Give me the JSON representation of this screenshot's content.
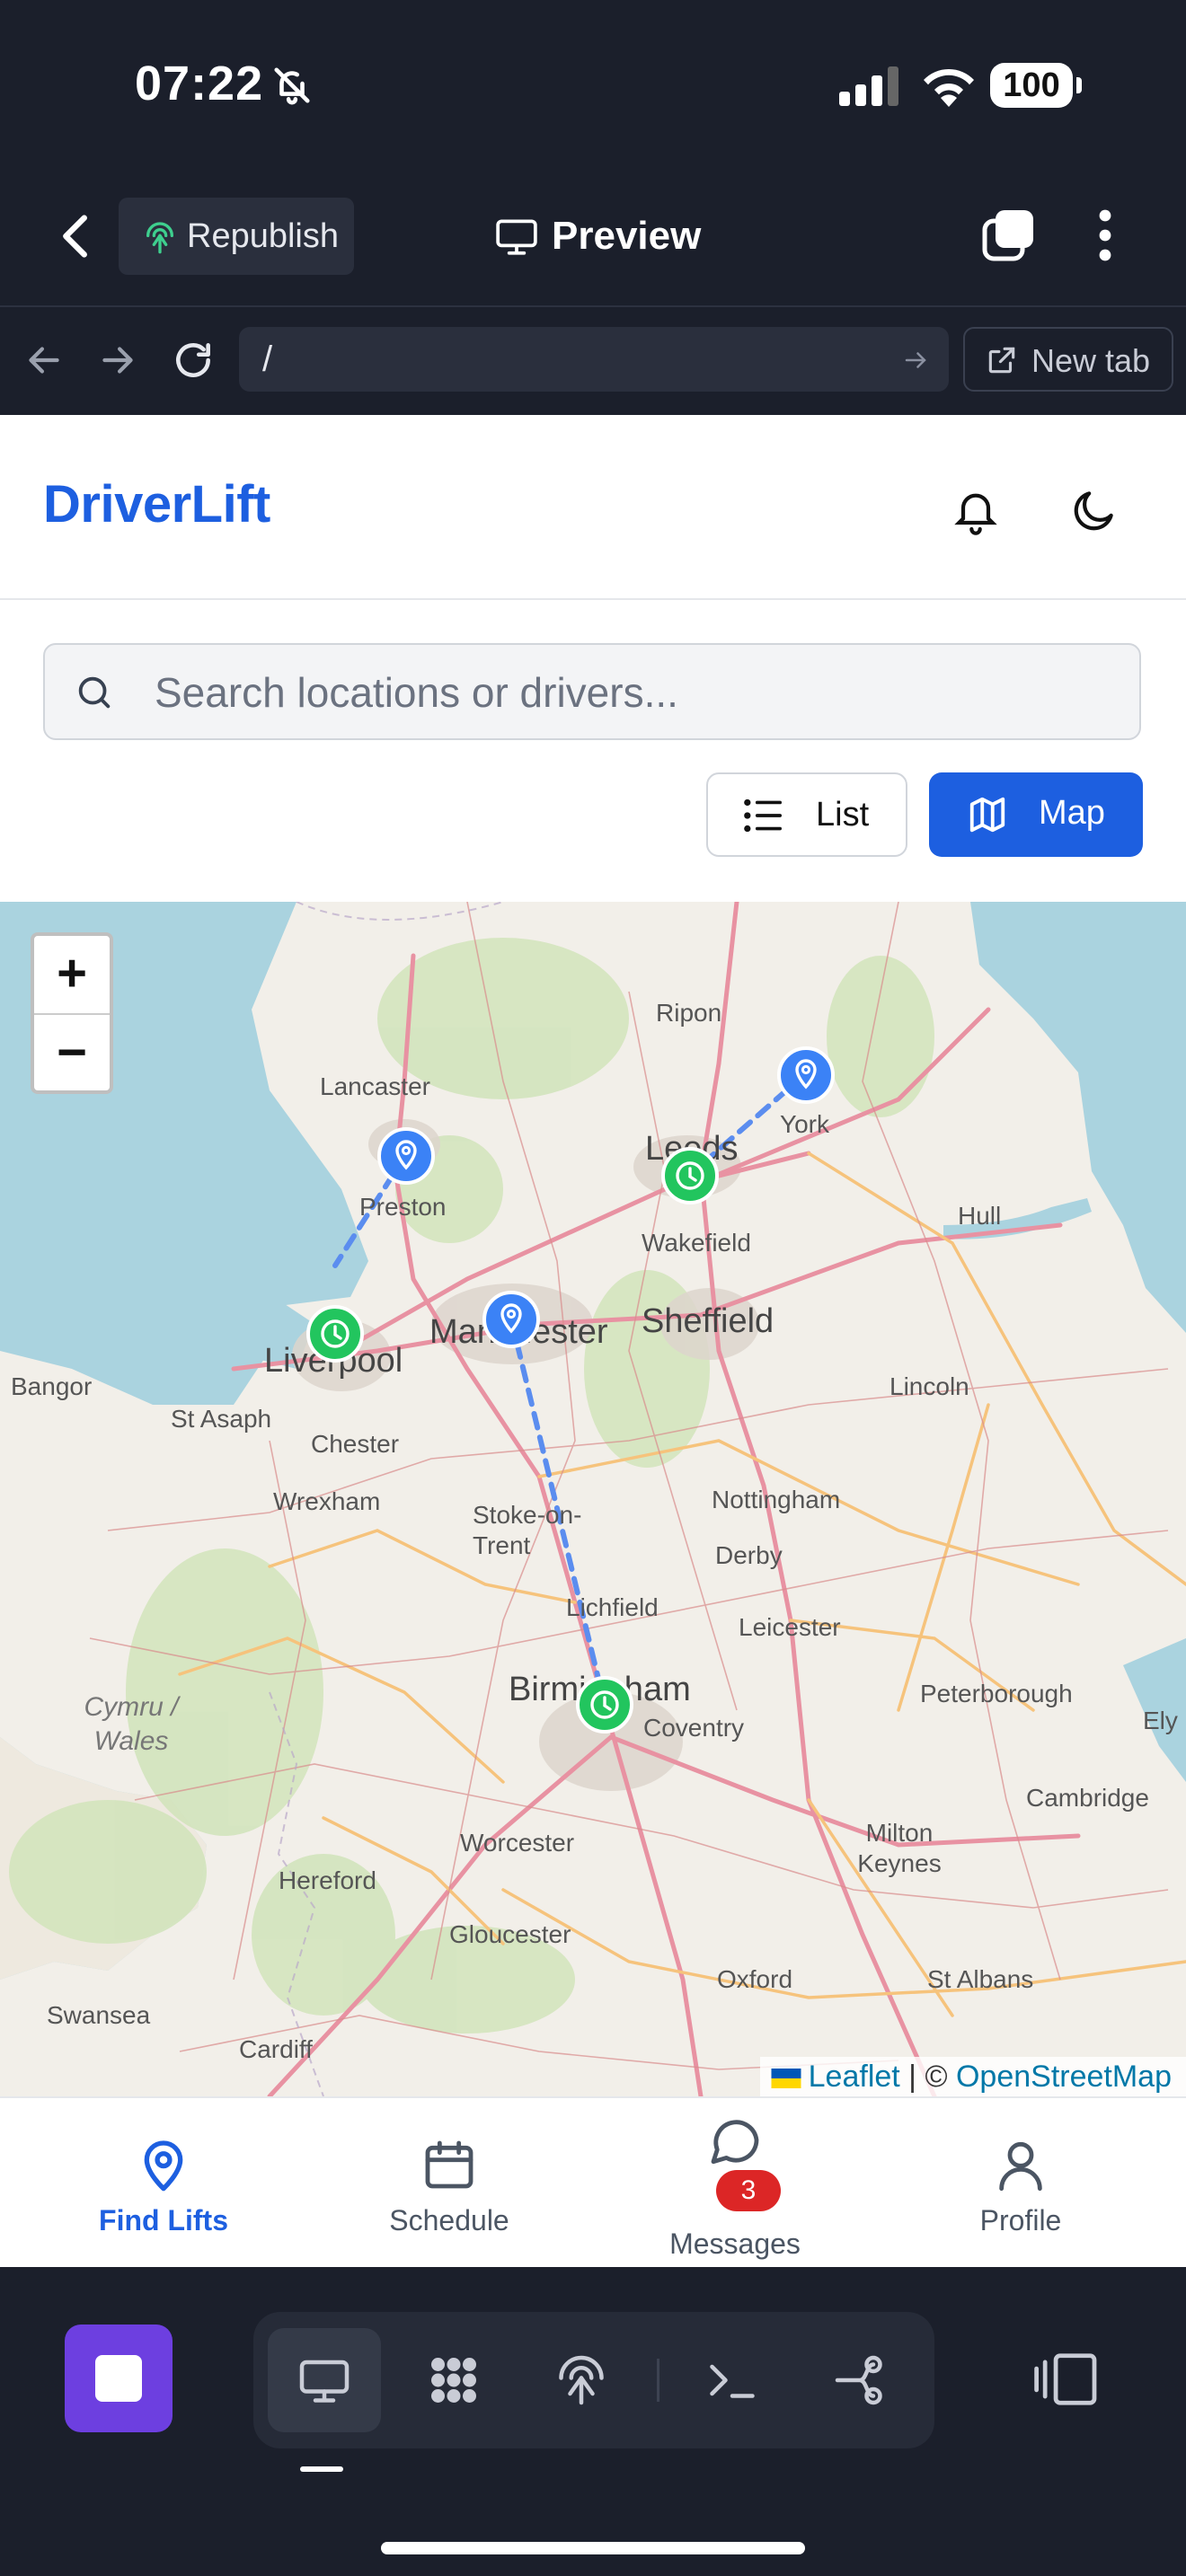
{
  "status_bar": {
    "time": "07:22",
    "battery": "100"
  },
  "app_bar": {
    "republish_label": "Republish",
    "preview_label": "Preview"
  },
  "url_bar": {
    "url": "/",
    "new_tab_label": "New tab"
  },
  "app": {
    "brand": "DriverLift",
    "search": {
      "placeholder": "Search locations or drivers...",
      "value": ""
    },
    "view_toggle": {
      "list_label": "List",
      "map_label": "Map",
      "active": "Map"
    }
  },
  "map": {
    "zoom_in": "+",
    "zoom_out": "−",
    "attribution": {
      "leaflet": "Leaflet",
      "separator": " | © ",
      "osm": "OpenStreetMap"
    },
    "place_labels": [
      "Ripon",
      "York",
      "Lancaster",
      "Preston",
      "Leeds",
      "Wakefield",
      "Hull",
      "Liverpool",
      "Manchester",
      "Sheffield",
      "Bangor",
      "St Asaph",
      "Lincoln",
      "Chester",
      "Wrexham",
      "Nottingham",
      "Stoke-on-Trent",
      "Derby",
      "Lichfield",
      "Leicester",
      "Birmingham",
      "Cymru / Wales",
      "Peterborough",
      "Coventry",
      "Ely",
      "Cambridge",
      "Milton Keynes",
      "Worcester",
      "Hereford",
      "Gloucester",
      "Oxford",
      "St Albans",
      "Swansea",
      "Cardiff"
    ],
    "markers": [
      {
        "type": "pickup",
        "icon": "map-pin-icon",
        "near": "York"
      },
      {
        "type": "dropoff",
        "icon": "clock-icon",
        "near": "Leeds"
      },
      {
        "type": "pickup",
        "icon": "map-pin-icon",
        "near": "Preston"
      },
      {
        "type": "dropoff",
        "icon": "clock-icon",
        "near": "Liverpool"
      },
      {
        "type": "pickup",
        "icon": "map-pin-icon",
        "near": "Manchester"
      },
      {
        "type": "dropoff",
        "icon": "clock-icon",
        "near": "Birmingham"
      }
    ],
    "colors": {
      "pickup": "#3b82f6",
      "dropoff": "#22c55e",
      "route": "#5b8def"
    }
  },
  "bottom_nav": {
    "items": [
      {
        "label": "Find Lifts",
        "icon": "map-pin-icon",
        "active": true
      },
      {
        "label": "Schedule",
        "icon": "calendar-icon",
        "active": false
      },
      {
        "label": "Messages",
        "icon": "message-icon",
        "badge": "3",
        "active": false
      },
      {
        "label": "Profile",
        "icon": "user-icon",
        "active": false
      }
    ]
  },
  "colors": {
    "accent": "#1d5fe0",
    "chrome": "#1b1f2b",
    "badge": "#dc2626",
    "stop": "#6d3fe0"
  }
}
